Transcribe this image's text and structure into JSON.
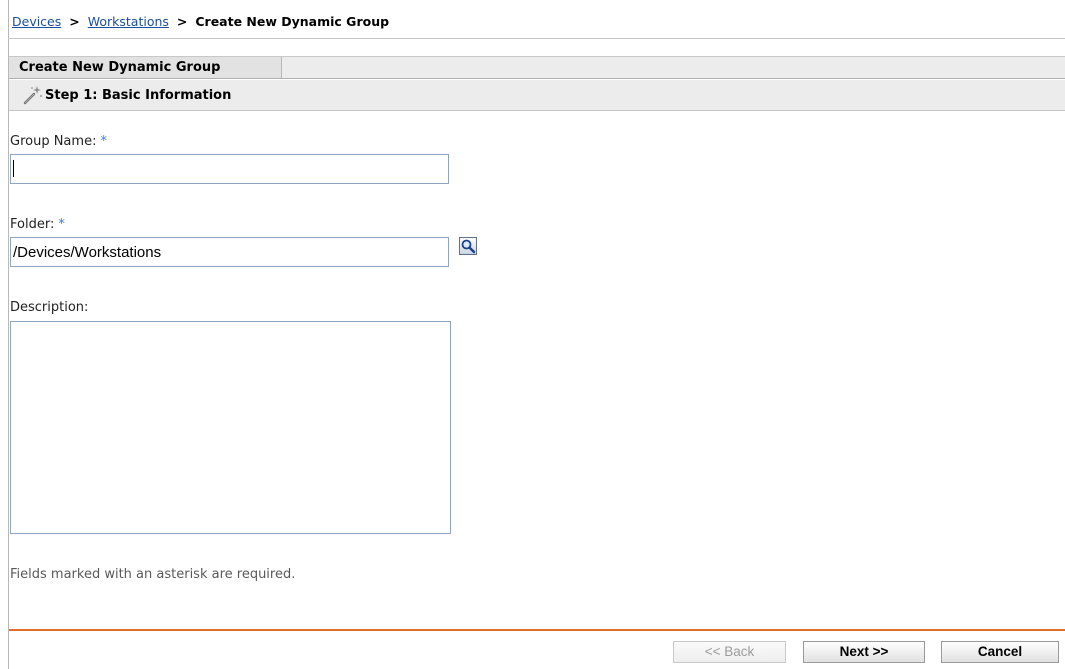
{
  "breadcrumb": {
    "items": [
      "Devices",
      "Workstations"
    ],
    "separator": ">",
    "current": "Create New Dynamic Group"
  },
  "tab": {
    "label": "Create New Dynamic Group"
  },
  "step": {
    "icon": "wand-icon",
    "title": "Step 1: Basic Information"
  },
  "form": {
    "group_name": {
      "label": "Group Name:",
      "required_mark": "*",
      "value": ""
    },
    "folder": {
      "label": "Folder:",
      "required_mark": "*",
      "value": "/Devices/Workstations",
      "lookup_icon": "magnifier-icon"
    },
    "description": {
      "label": "Description:",
      "value": ""
    },
    "required_note": "Fields marked with an asterisk are required."
  },
  "buttons": {
    "back": {
      "label": "<< Back",
      "enabled": false
    },
    "next": {
      "label": "Next >>",
      "enabled": true
    },
    "cancel": {
      "label": "Cancel",
      "enabled": true
    }
  },
  "colors": {
    "link": "#1a4fa0",
    "required_mark": "#3a7bd5",
    "footer_rule": "#e36c2a",
    "input_border": "#8ea4bf"
  }
}
